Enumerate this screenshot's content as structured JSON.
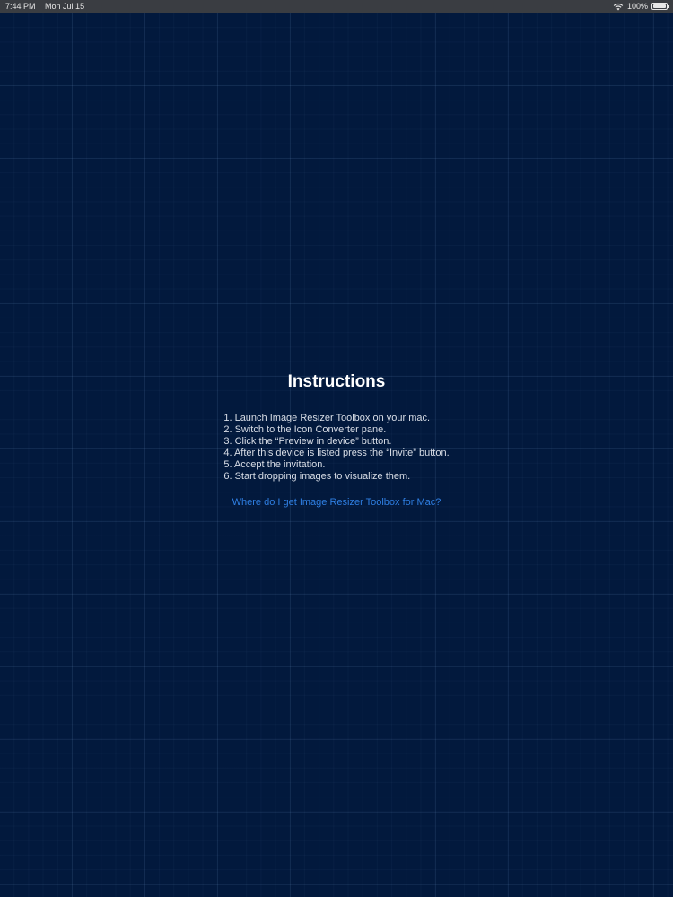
{
  "status_bar": {
    "time": "7:44 PM",
    "date": "Mon Jul 15",
    "battery_percent": "100%",
    "battery_level": 1.0,
    "wifi_icon": "wifi-icon",
    "battery_icon": "battery-icon"
  },
  "instructions": {
    "title": "Instructions",
    "steps": [
      "1. Launch Image Resizer Toolbox on your mac.",
      "2. Switch to the Icon Converter pane.",
      "3. Click the “Preview in device” button.",
      "4. After this device is listed press the “Invite” button.",
      "5. Accept the invitation.",
      "6. Start dropping images to visualize them."
    ],
    "help_link": "Where do I get Image Resizer Toolbox for Mac?"
  },
  "colors": {
    "background": "#02193d",
    "link": "#2f7fe3",
    "status_bar": "#3a3d42"
  }
}
